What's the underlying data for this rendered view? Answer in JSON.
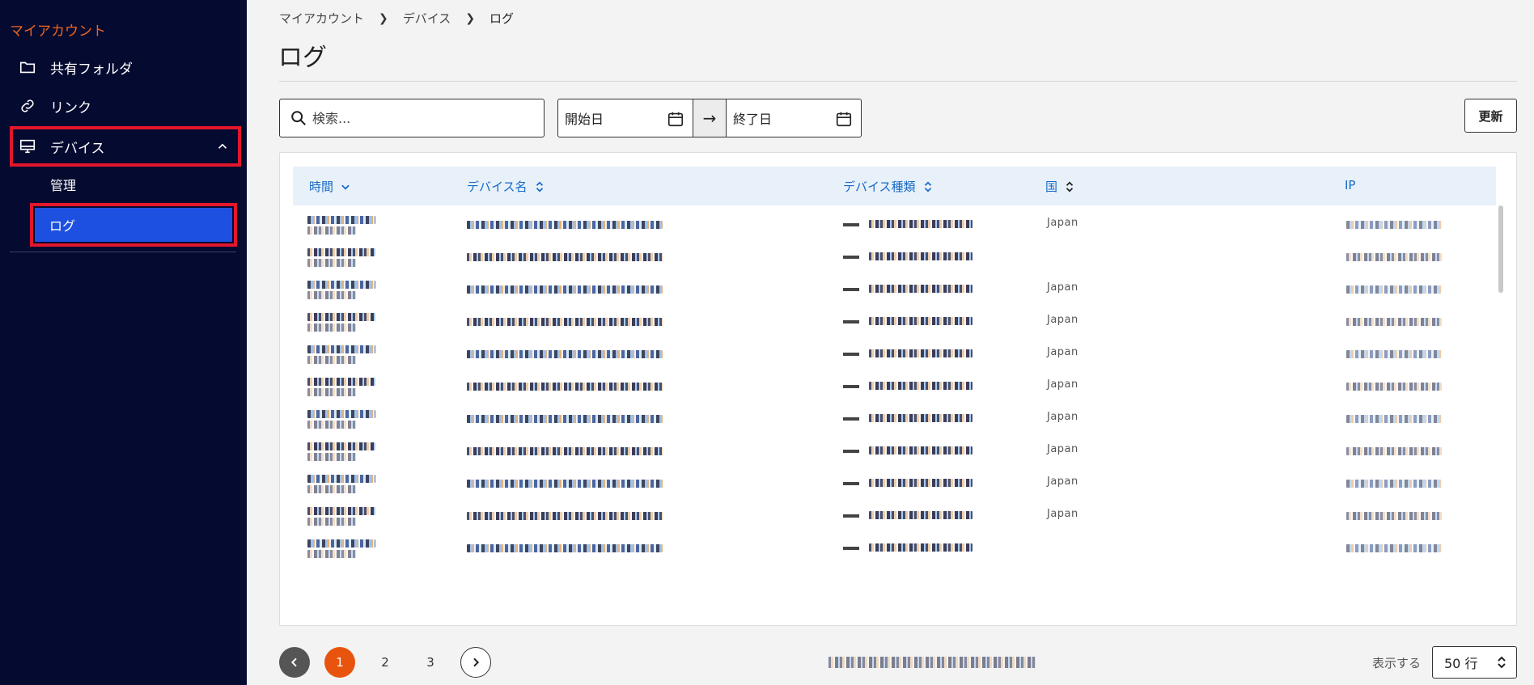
{
  "sidebar": {
    "title": "マイアカウント",
    "items": [
      {
        "label": "共有フォルダ",
        "icon": "folder-icon"
      },
      {
        "label": "リンク",
        "icon": "link-icon"
      },
      {
        "label": "デバイス",
        "icon": "monitor-icon"
      }
    ],
    "sub_items": [
      {
        "label": "管理"
      },
      {
        "label": "ログ"
      }
    ]
  },
  "breadcrumb": [
    "マイアカウント",
    "デバイス",
    "ログ"
  ],
  "page_title": "ログ",
  "filters": {
    "search_placeholder": "検索...",
    "start_date_placeholder": "開始日",
    "end_date_placeholder": "終了日",
    "arrow": "→",
    "refresh_label": "更新"
  },
  "table": {
    "columns": [
      "時間",
      "デバイス名",
      "デバイス種類",
      "国",
      "IP"
    ],
    "rows": [
      {
        "country": "Japan"
      },
      {
        "country": ""
      },
      {
        "country": "Japan"
      },
      {
        "country": "Japan"
      },
      {
        "country": "Japan"
      },
      {
        "country": "Japan"
      },
      {
        "country": "Japan"
      },
      {
        "country": "Japan"
      },
      {
        "country": "Japan"
      },
      {
        "country": "Japan"
      },
      {
        "country": ""
      }
    ]
  },
  "pagination": {
    "pages": [
      "1",
      "2",
      "3"
    ],
    "current": "1",
    "rows_label": "表示する",
    "rows_value": "50 行"
  },
  "colors": {
    "sidebar_bg": "#050a30",
    "accent_orange": "#e8540e",
    "active_blue": "#1d4fe0",
    "highlight_red": "#e3162c",
    "header_link": "#1769c5"
  }
}
